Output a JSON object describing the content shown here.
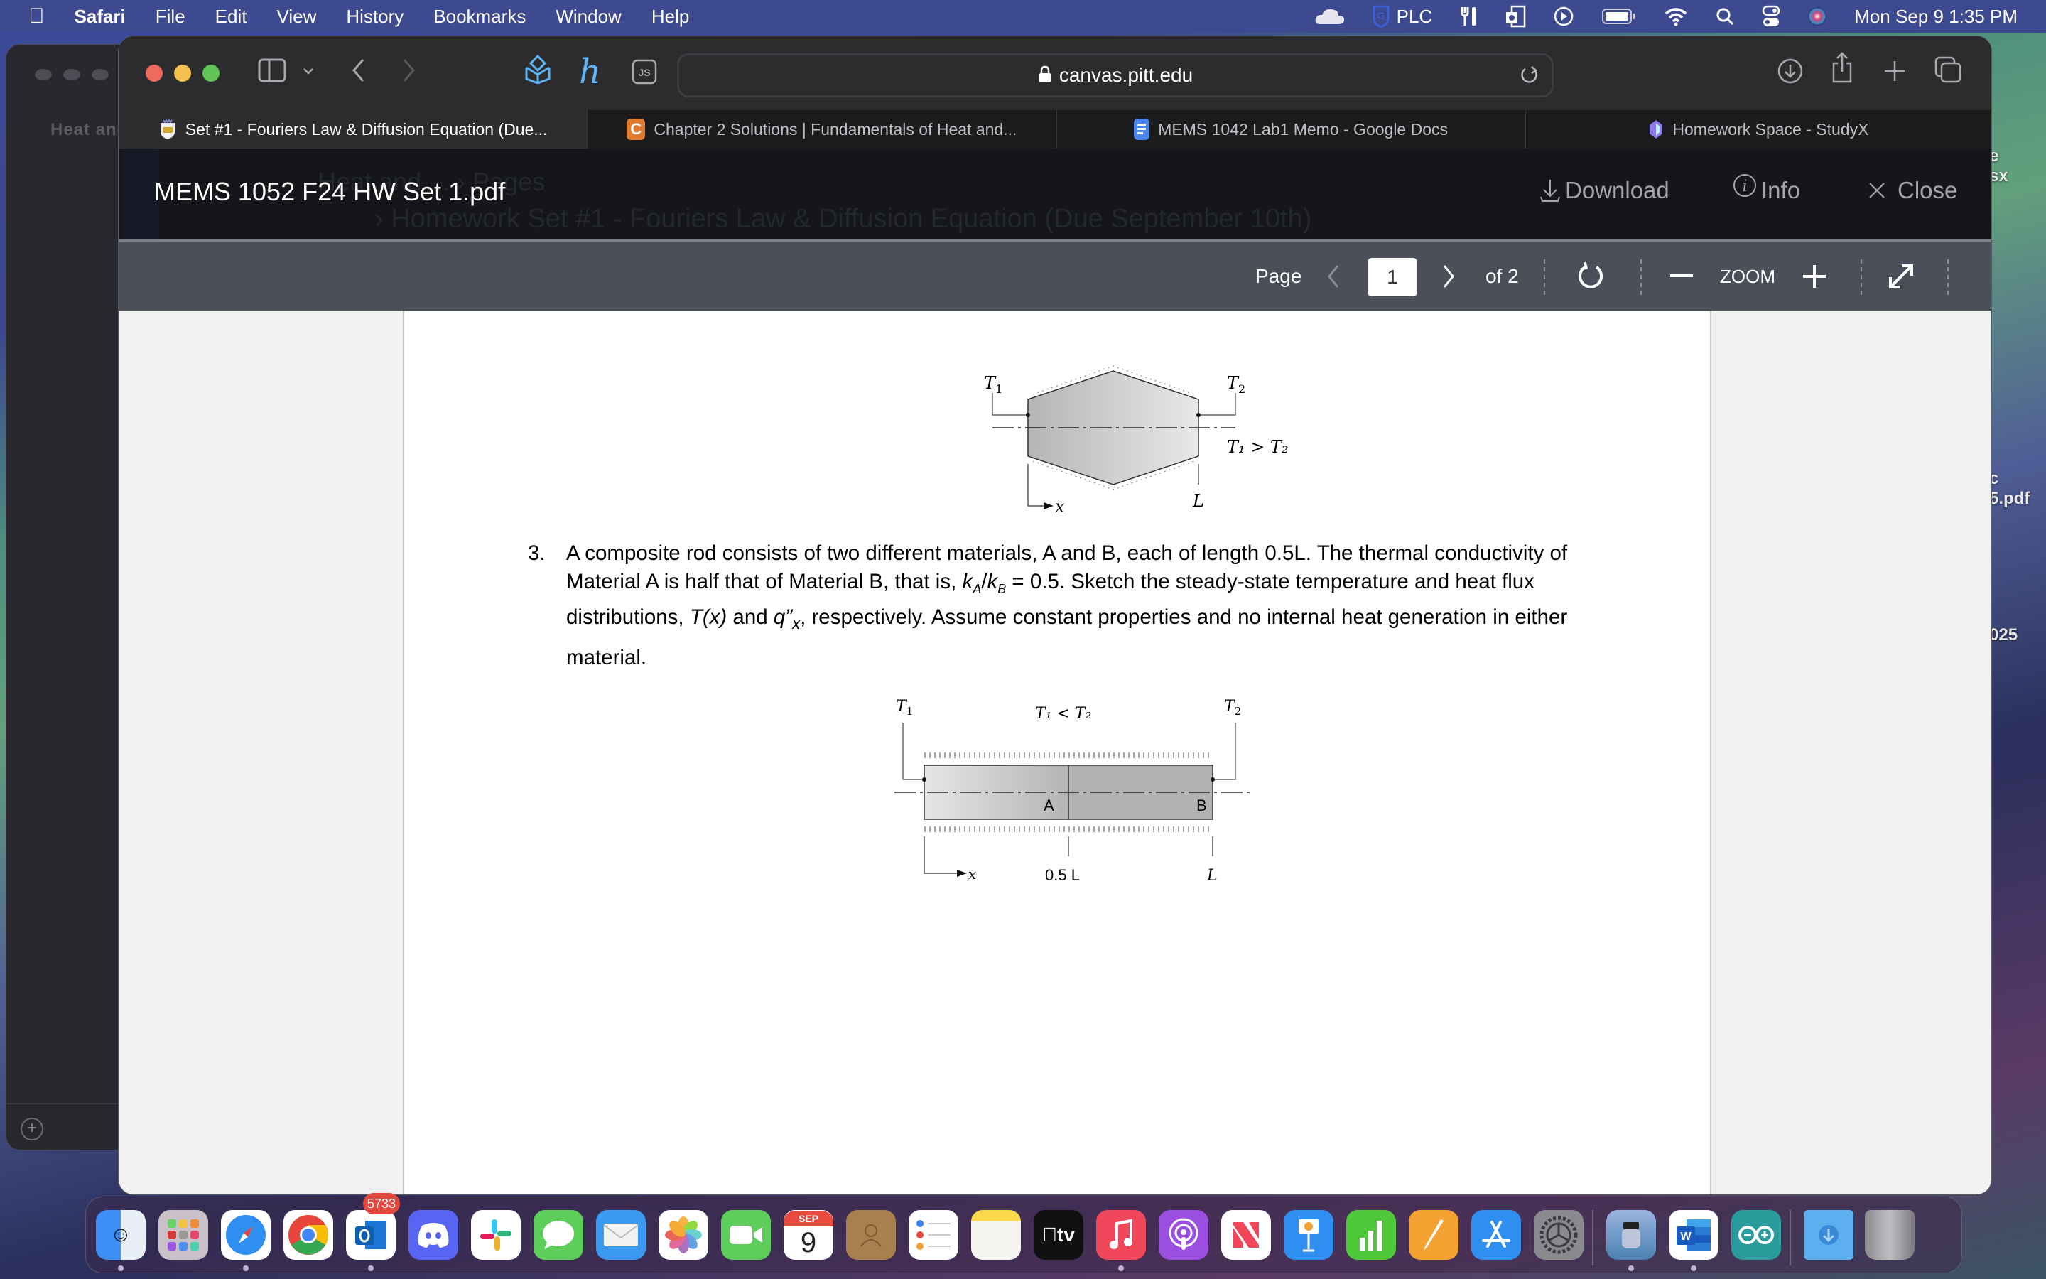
{
  "menubar": {
    "apple": "",
    "app_name": "Safari",
    "items": [
      "File",
      "Edit",
      "View",
      "History",
      "Bookmarks",
      "Window",
      "Help"
    ],
    "status": {
      "plc_label": "PLC",
      "datetime": "Mon Sep 9  1:35 PM"
    }
  },
  "desktop": {
    "files": [
      {
        "partial_line1": "e",
        "partial_line2": "sx"
      },
      {
        "partial_line1": "c",
        "partial_line2": "5.pdf"
      },
      {
        "partial_line1": "025"
      }
    ]
  },
  "back_window": {
    "title_partial": "Heat and"
  },
  "browser": {
    "url": "canvas.pitt.edu",
    "tabs": [
      {
        "label": "Set #1 - Fouriers Law & Diffusion Equation (Due...",
        "active": true,
        "favicon": "pitt-crest"
      },
      {
        "label": "Chapter 2 Solutions | Fundamentals of Heat and...",
        "active": false,
        "favicon": "C"
      },
      {
        "label": "MEMS 1042 Lab1 Memo - Google Docs",
        "active": false,
        "favicon": "google-docs"
      },
      {
        "label": "Homework Space - StudyX",
        "active": false,
        "favicon": "studyx"
      }
    ],
    "extensions": [
      "box-extension",
      "h-extension",
      "JS"
    ]
  },
  "viewer": {
    "file_name": "MEMS 1052 F24 HW Set 1.pdf",
    "ghost_breadcrumb": "Heat and ...  ›  Pages",
    "ghost_title": "›  Homework Set #1 - Fouriers Law & Diffusion Equation (Due September 10th)",
    "download_label": "Download",
    "info_label": "Info",
    "close_label": "Close",
    "page_label": "Page",
    "current_page": "1",
    "total_pages_label": "of 2",
    "zoom_label": "ZOOM"
  },
  "document": {
    "figure1": {
      "t1": "T",
      "t1_sub": "1",
      "t2": "T",
      "t2_sub": "2",
      "condition": "T₁ > T₂",
      "length_label": "L",
      "x_label": "x"
    },
    "question": {
      "number": "3.",
      "line1": "A composite rod consists of two different materials, A and B, each of length 0.5L.  The thermal conductivity of",
      "line2": "Material A is half that of Material B, that is, kₐ/kᵦ = 0.5. Sketch the steady-state temperature and heat flux",
      "line2_parts": {
        "pre": "Material A is half that of Material B, that is, ",
        "ka": "k",
        "ka_sub": "A",
        "slash": "/",
        "kb": "k",
        "kb_sub": "B",
        "post": " = 0.5. Sketch the steady-state temperature and heat flux"
      },
      "line3_parts": {
        "pre": "distributions, ",
        "tx": "T(x)",
        "mid": " and ",
        "q": "q”",
        "q_sub": "x",
        "post": ", respectively. Assume constant properties and no internal heat generation in either"
      },
      "line4": "material."
    },
    "figure2": {
      "t1": "T",
      "t1_sub": "1",
      "t2": "T",
      "t2_sub": "2",
      "condition": "T₁ < T₂",
      "material_a": "A",
      "material_b": "B",
      "mid_label": "0.5 L",
      "length_label": "L",
      "x_label": "x"
    }
  },
  "dock": {
    "apps": [
      "Finder",
      "Launchpad",
      "Safari",
      "Chrome",
      "Outlook",
      "Discord",
      "Slack",
      "Messages",
      "Mail",
      "Photos",
      "FaceTime",
      "Calendar",
      "Contacts",
      "Reminders",
      "Notes",
      "Apple TV",
      "Music",
      "Podcasts",
      "News",
      "Keynote",
      "Numbers",
      "Pages",
      "App Store",
      "System Settings",
      "Preview",
      "Word",
      "Arduino",
      "Downloads",
      "Trash"
    ],
    "outlook_badge": "5733",
    "calendar_month": "SEP",
    "calendar_day": "9",
    "tv_label": "tv"
  }
}
